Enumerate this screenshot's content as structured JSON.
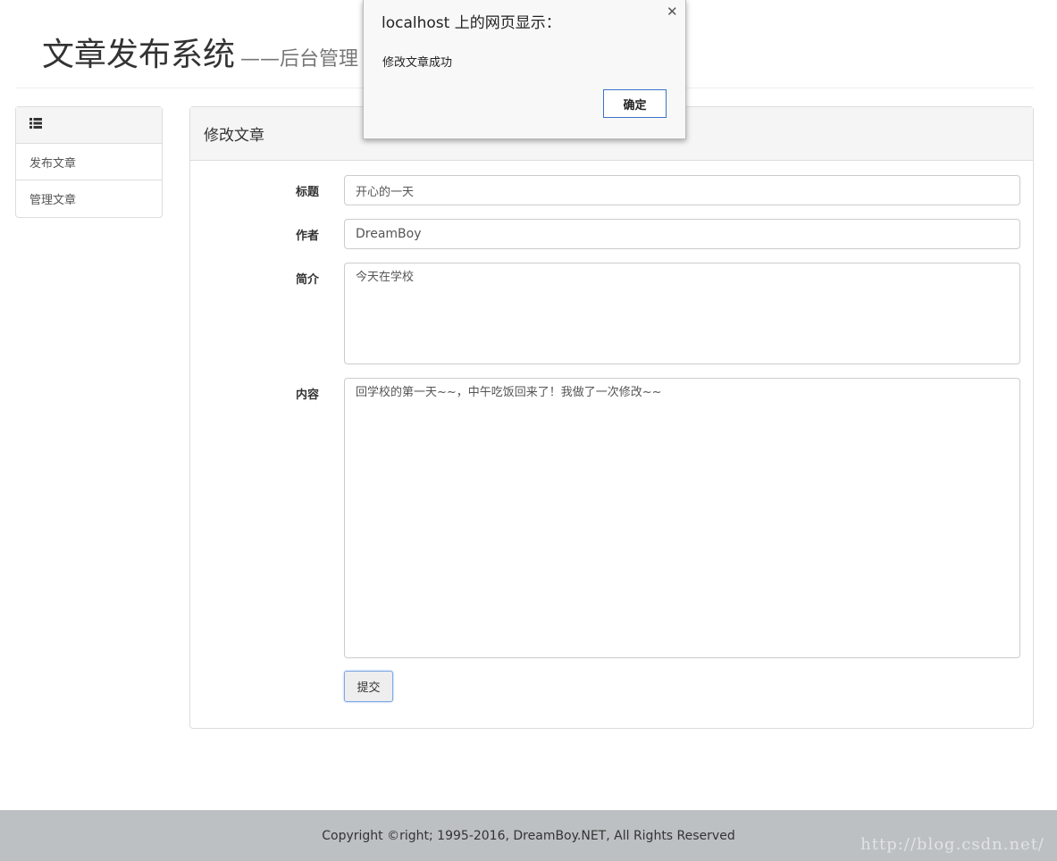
{
  "header": {
    "title": "文章发布系统",
    "subtitle": "——后台管理"
  },
  "sidebar": {
    "icon": "list-icon",
    "items": [
      {
        "label": "发布文章"
      },
      {
        "label": "管理文章"
      }
    ]
  },
  "panel": {
    "title": "修改文章",
    "fields": {
      "title_label": "标题",
      "title_value": "开心的一天",
      "author_label": "作者",
      "author_value": "DreamBoy",
      "summary_label": "简介",
      "summary_value": "今天在学校",
      "content_label": "内容",
      "content_value": "回学校的第一天~~，中午吃饭回来了！我做了一次修改~~"
    },
    "submit_label": "提交"
  },
  "footer": {
    "copyright": "Copyright ©right; 1995-2016, DreamBoy.NET, All Rights Reserved"
  },
  "dialog": {
    "title": "localhost 上的网页显示：",
    "message": "修改文章成功",
    "ok_label": "确定",
    "close_icon": "close-icon"
  },
  "watermark": "http://blog.csdn.net/"
}
